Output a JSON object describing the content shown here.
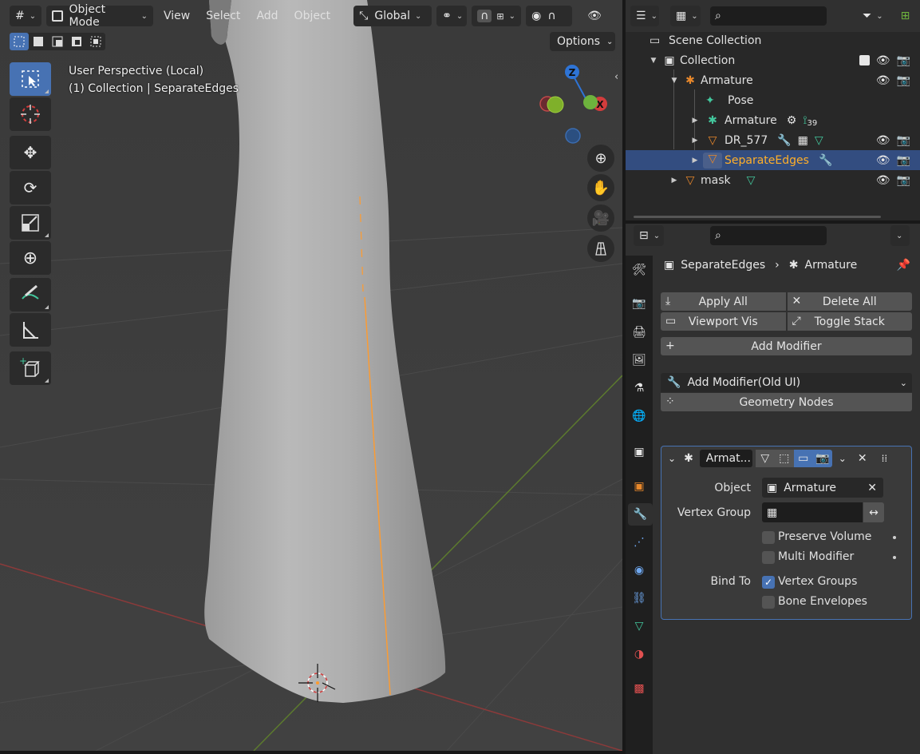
{
  "viewport": {
    "header": {
      "mode": "Object Mode",
      "menus": [
        "View",
        "Select",
        "Add",
        "Object"
      ],
      "orientation": "Global"
    },
    "options_label": "Options",
    "info_line1": "User Perspective (Local)",
    "info_line2": "(1) Collection | SeparateEdges",
    "gizmo": {
      "z": "Z",
      "x": "X"
    }
  },
  "outliner": {
    "rows": [
      {
        "label": "Scene Collection"
      },
      {
        "label": "Collection"
      },
      {
        "label": "Armature"
      },
      {
        "label": "Pose"
      },
      {
        "label": "Armature",
        "bone_count": "39"
      },
      {
        "label": "DR_577"
      },
      {
        "label": "SeparateEdges"
      },
      {
        "label": "mask"
      }
    ]
  },
  "properties": {
    "breadcrumb": {
      "object": "SeparateEdges",
      "modifier": "Armature"
    },
    "buttons": {
      "apply_all": "Apply All",
      "delete_all": "Delete All",
      "viewport_vis": "Viewport Vis",
      "toggle_stack": "Toggle Stack",
      "add_modifier": "Add Modifier",
      "add_modifier_old": "Add Modifier(Old UI)",
      "geometry_nodes": "Geometry Nodes"
    },
    "modifier": {
      "name": "Armat...",
      "object_label": "Object",
      "object_value": "Armature",
      "vertex_group_label": "Vertex Group",
      "vertex_group_value": "",
      "preserve_volume": "Preserve Volume",
      "multi_modifier": "Multi Modifier",
      "bind_to_label": "Bind To",
      "vertex_groups": "Vertex Groups",
      "bone_envelopes": "Bone Envelopes",
      "preserve_volume_checked": false,
      "multi_modifier_checked": false,
      "vertex_groups_checked": true,
      "bone_envelopes_checked": false
    }
  },
  "colors": {
    "accent": "#4772b3",
    "selected_text": "#ffaf29",
    "object_orange": "#e8882b",
    "mesh_green": "#43c79d",
    "panel": "#303030"
  }
}
